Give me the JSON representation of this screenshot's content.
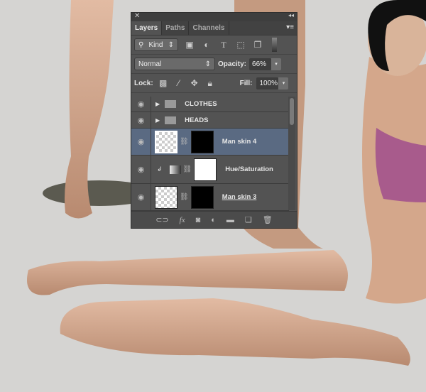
{
  "panel": {
    "close": "✕",
    "collapse": "◂◂",
    "tabs": [
      "Layers",
      "Paths",
      "Channels"
    ],
    "menu_icon": "panel-menu-icon",
    "filter": {
      "label": "Kind"
    },
    "blend_mode": "Normal",
    "opacity_label": "Opacity:",
    "opacity_value": "66%",
    "lock_label": "Lock:",
    "fill_label": "Fill:",
    "fill_value": "100%",
    "layers": [
      {
        "name": "CLOTHES",
        "type": "group"
      },
      {
        "name": "HEADS",
        "type": "group"
      },
      {
        "name": "Man skin 4",
        "type": "masked",
        "selected": true
      },
      {
        "name": "Hue/Saturation",
        "type": "adjustment"
      },
      {
        "name": "Man skin 3",
        "type": "masked"
      }
    ]
  },
  "colors": {
    "selected_row": "#5a6a82",
    "panel": "#535353",
    "background": "#d5d4d2"
  }
}
